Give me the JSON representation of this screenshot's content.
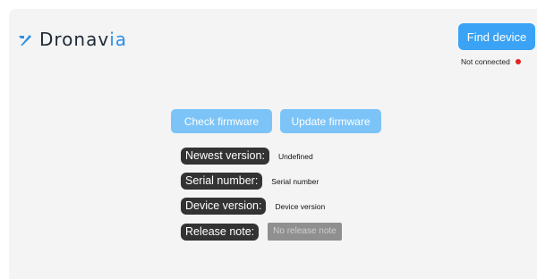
{
  "header": {
    "logo_icon": "slash-arrow-icon",
    "logo_text_main": "Dronav",
    "logo_text_accent": "ia",
    "brand_color": "#1f2a36",
    "accent_color": "#2b8fe8"
  },
  "connection": {
    "find_device_label": "Find device",
    "status_text": "Not connected",
    "status_color": "#e0231f"
  },
  "actions": {
    "check_firmware_label": "Check firmware",
    "update_firmware_label": "Update firmware"
  },
  "info": {
    "newest_version": {
      "label": "Newest version:",
      "value": "Undefined"
    },
    "serial_number": {
      "label": "Serial number:",
      "value": "Serial number"
    },
    "device_version": {
      "label": "Device version:",
      "value": "Device version"
    },
    "release_note": {
      "label": "Release note:",
      "button_label": "No release note"
    }
  }
}
